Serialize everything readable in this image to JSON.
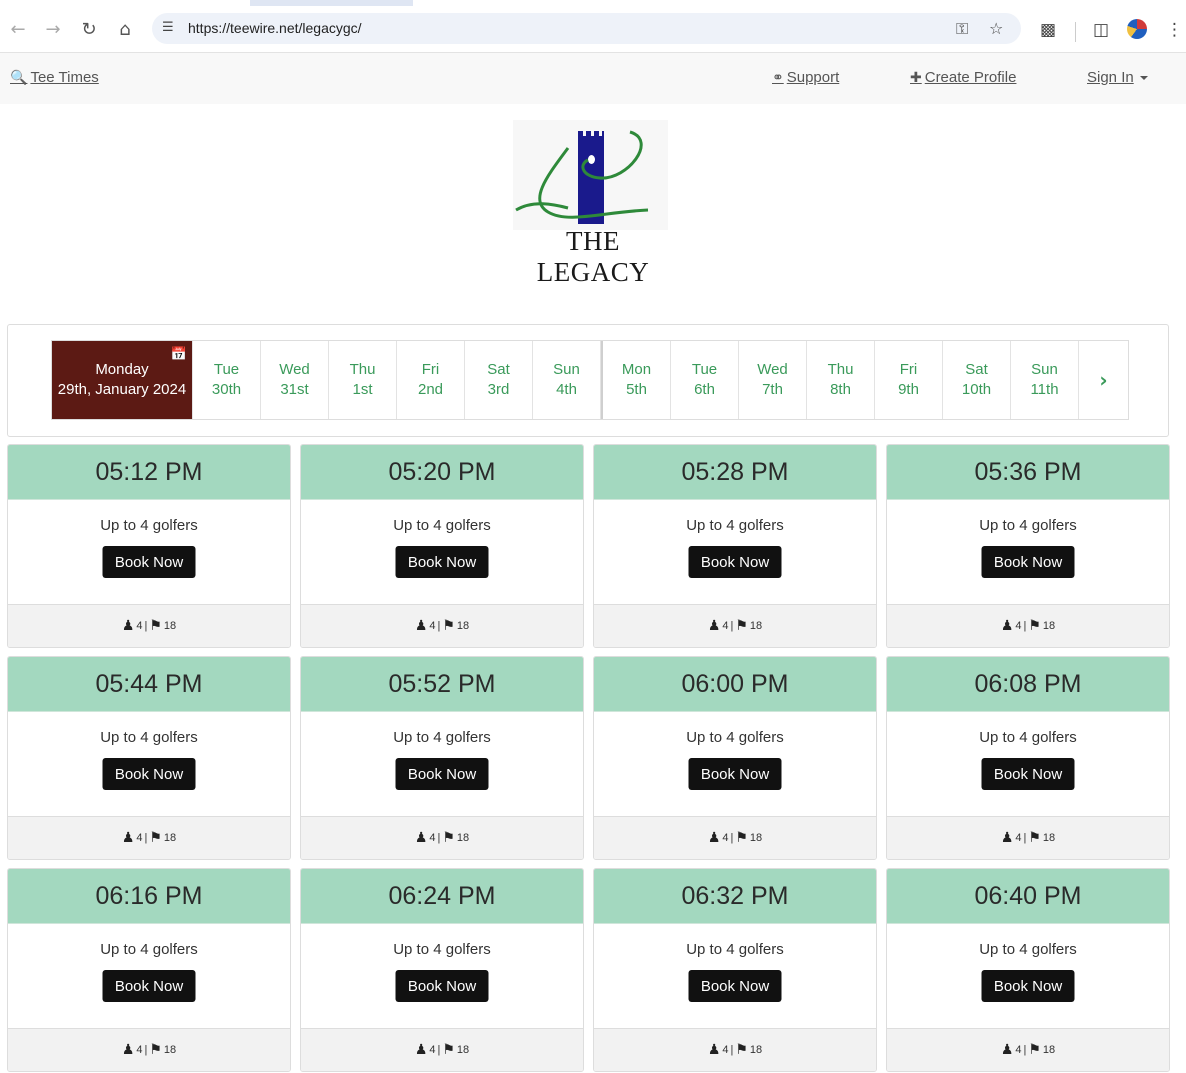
{
  "browser": {
    "url": "https://teewire.net/legacygc/",
    "icons": [
      "back-icon",
      "forward-icon",
      "reload-icon",
      "home-icon",
      "site-info-icon",
      "key-icon",
      "star-icon",
      "extensions-icon",
      "sidepanel-icon",
      "profile-avatar",
      "menu-icon"
    ]
  },
  "nav": {
    "tee_times": "Tee Times",
    "support": "Support",
    "create_profile": "Create Profile",
    "sign_in": "Sign In"
  },
  "logo": {
    "text": "THE LEGACY"
  },
  "dates": {
    "selected": {
      "weekday": "Monday",
      "date": "29th, January 2024"
    },
    "days": [
      {
        "w": "Tue",
        "d": "30th"
      },
      {
        "w": "Wed",
        "d": "31st"
      },
      {
        "w": "Thu",
        "d": "1st"
      },
      {
        "w": "Fri",
        "d": "2nd"
      },
      {
        "w": "Sat",
        "d": "3rd"
      },
      {
        "w": "Sun",
        "d": "4th"
      },
      {
        "w": "Mon",
        "d": "5th"
      },
      {
        "w": "Tue",
        "d": "6th"
      },
      {
        "w": "Wed",
        "d": "7th"
      },
      {
        "w": "Thu",
        "d": "8th"
      },
      {
        "w": "Fri",
        "d": "9th"
      },
      {
        "w": "Sat",
        "d": "10th"
      },
      {
        "w": "Sun",
        "d": "11th"
      }
    ]
  },
  "slots": [
    {
      "time": "05:12 PM",
      "golfers": "Up to 4 golfers",
      "book": "Book Now",
      "players": "4",
      "holes": "18"
    },
    {
      "time": "05:20 PM",
      "golfers": "Up to 4 golfers",
      "book": "Book Now",
      "players": "4",
      "holes": "18"
    },
    {
      "time": "05:28 PM",
      "golfers": "Up to 4 golfers",
      "book": "Book Now",
      "players": "4",
      "holes": "18"
    },
    {
      "time": "05:36 PM",
      "golfers": "Up to 4 golfers",
      "book": "Book Now",
      "players": "4",
      "holes": "18"
    },
    {
      "time": "05:44 PM",
      "golfers": "Up to 4 golfers",
      "book": "Book Now",
      "players": "4",
      "holes": "18"
    },
    {
      "time": "05:52 PM",
      "golfers": "Up to 4 golfers",
      "book": "Book Now",
      "players": "4",
      "holes": "18"
    },
    {
      "time": "06:00 PM",
      "golfers": "Up to 4 golfers",
      "book": "Book Now",
      "players": "4",
      "holes": "18"
    },
    {
      "time": "06:08 PM",
      "golfers": "Up to 4 golfers",
      "book": "Book Now",
      "players": "4",
      "holes": "18"
    },
    {
      "time": "06:16 PM",
      "golfers": "Up to 4 golfers",
      "book": "Book Now",
      "players": "4",
      "holes": "18"
    },
    {
      "time": "06:24 PM",
      "golfers": "Up to 4 golfers",
      "book": "Book Now",
      "players": "4",
      "holes": "18"
    },
    {
      "time": "06:32 PM",
      "golfers": "Up to 4 golfers",
      "book": "Book Now",
      "players": "4",
      "holes": "18"
    },
    {
      "time": "06:40 PM",
      "golfers": "Up to 4 golfers",
      "book": "Book Now",
      "players": "4",
      "holes": "18"
    }
  ],
  "colors": {
    "selected_day": "#5c1a14",
    "slot_header": "#a3d8bf",
    "day_text": "#3a9a5a",
    "book_button": "#111111"
  }
}
